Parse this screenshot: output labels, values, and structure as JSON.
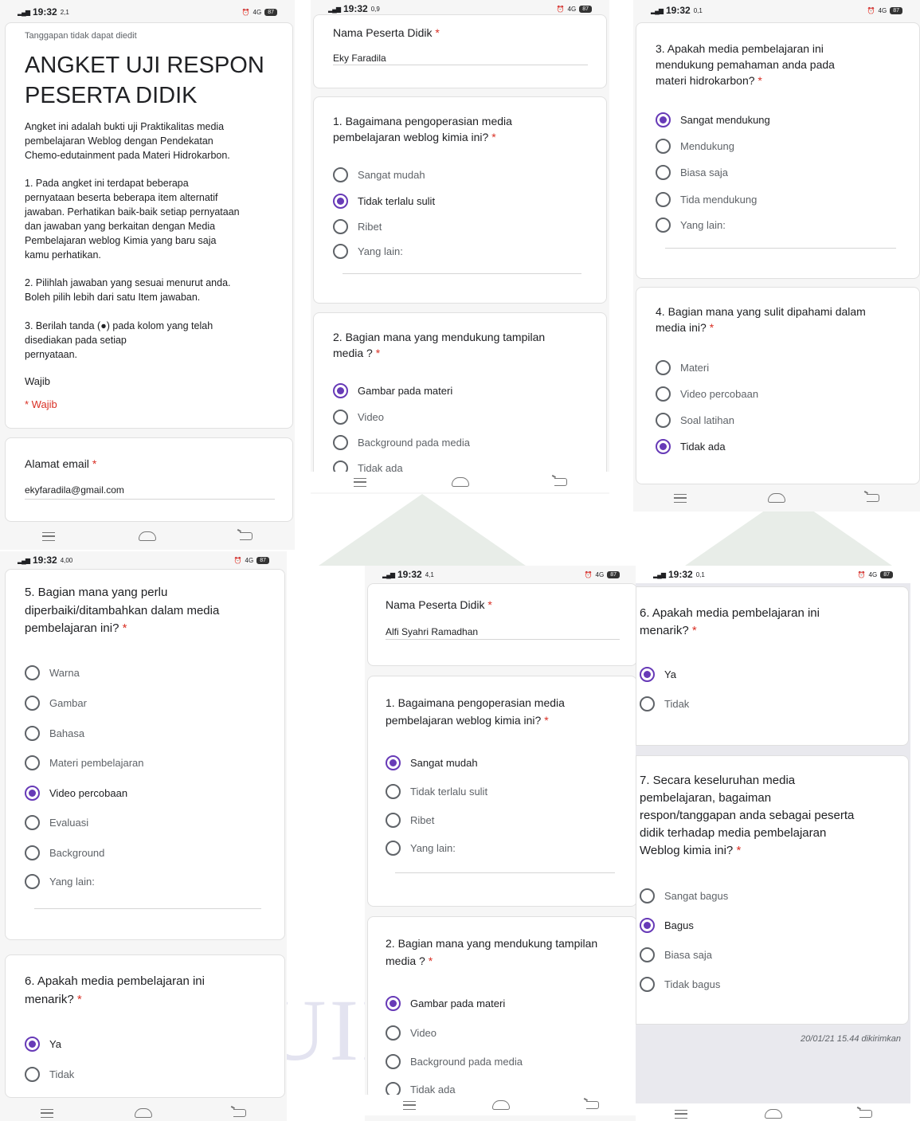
{
  "status_time": "19:32",
  "status_speeds": [
    "2,1",
    "0,9",
    "0,1",
    "4,00",
    "4,1",
    "0,1"
  ],
  "battery": "87",
  "net": "4G",
  "s1": {
    "notice": "Tanggapan tidak dapat diedit",
    "title_line1": "ANGKET UJI RESPON",
    "title_line2": "PESERTA DIDIK",
    "desc_lines": [
      "Angket ini adalah bukti uji Praktikalitas media",
      "pembelajaran Weblog dengan Pendekatan",
      "Chemo-edutainment pada Materi Hidrokarbon."
    ],
    "instr1_lines": [
      "1. Pada angket ini terdapat beberapa",
      "pernyataan beserta beberapa item alternatif",
      "jawaban. Perhatikan baik-baik setiap pernyataan",
      "dan jawaban yang berkaitan dengan Media",
      "Pembelajaran weblog Kimia yang baru saja",
      "kamu perhatikan."
    ],
    "instr2_lines": [
      "2. Pilihlah jawaban yang sesuai menurut anda.",
      "Boleh pilih lebih dari satu Item jawaban."
    ],
    "instr3_lines": [
      "3. Berilah tanda (●) pada kolom yang telah",
      "disediakan pada setiap",
      "pernyataan."
    ],
    "wajib": "Wajib",
    "wajib_req": "* Wajib",
    "email_label": "Alamat email",
    "email_value": "ekyfaradila@gmail.com"
  },
  "s2": {
    "name_label": "Nama Peserta Didik",
    "name_value": "Eky Faradila",
    "q1_lines": [
      "1. Bagaimana pengoperasian media",
      "pembelajaran weblog kimia ini?"
    ],
    "q1_options": [
      "Sangat mudah",
      "Tidak terlalu sulit",
      "Ribet",
      "Yang lain:"
    ],
    "q2_lines": [
      "2. Bagian mana yang mendukung tampilan",
      "media ?"
    ],
    "q2_options": [
      "Gambar pada materi",
      "Video",
      "Background pada media",
      "Tidak ada"
    ]
  },
  "s3": {
    "q3_lines": [
      "3. Apakah media pembelajaran ini",
      "mendukung pemahaman anda pada",
      "materi hidrokarbon?"
    ],
    "q3_options": [
      "Sangat mendukung",
      "Mendukung",
      "Biasa saja",
      "Tida mendukung",
      "Yang lain:"
    ],
    "q4_lines": [
      "4. Bagian mana yang sulit dipahami dalam",
      "media ini?"
    ],
    "q4_options": [
      "Materi",
      "Video percobaan",
      "Soal latihan",
      "Tidak ada"
    ]
  },
  "s4": {
    "q5_lines": [
      "5. Bagian mana yang perlu",
      "diperbaiki/ditambahkan dalam media",
      "pembelajaran ini?"
    ],
    "q5_options": [
      "Warna",
      "Gambar",
      "Bahasa",
      "Materi pembelajaran",
      "Video percobaan",
      "Evaluasi",
      "Background",
      "Yang lain:"
    ],
    "q6_lines": [
      "6. Apakah media pembelajaran ini",
      "menarik?"
    ],
    "q6_options": [
      "Ya",
      "Tidak"
    ]
  },
  "s5": {
    "name_label": "Nama Peserta Didik",
    "name_value": "Alfi Syahri Ramadhan",
    "q1_lines": [
      "1. Bagaimana pengoperasian media",
      "pembelajaran weblog kimia ini?"
    ],
    "q1_options": [
      "Sangat mudah",
      "Tidak terlalu sulit",
      "Ribet",
      "Yang lain:"
    ],
    "q2_lines": [
      "2. Bagian mana yang mendukung tampilan",
      "media ?"
    ],
    "q2_options": [
      "Gambar pada materi",
      "Video",
      "Background pada media",
      "Tidak ada"
    ]
  },
  "s6": {
    "q6_lines": [
      "6. Apakah media pembelajaran ini",
      "menarik?"
    ],
    "q6_options": [
      "Ya",
      "Tidak"
    ],
    "q7_lines": [
      "7. Secara keseluruhan media",
      "pembelajaran, bagaiman",
      "respon/tanggapan anda sebagai peserta",
      "didik terhadap media pembelajaran",
      "Weblog kimia ini?"
    ],
    "q7_options": [
      "Sangat bagus",
      "Bagus",
      "Biasa saja",
      "Tidak bagus"
    ],
    "submitted": "20/01/21 15.44 dikirimkan"
  },
  "watermark_text": "UIN",
  "required_mark": "*"
}
